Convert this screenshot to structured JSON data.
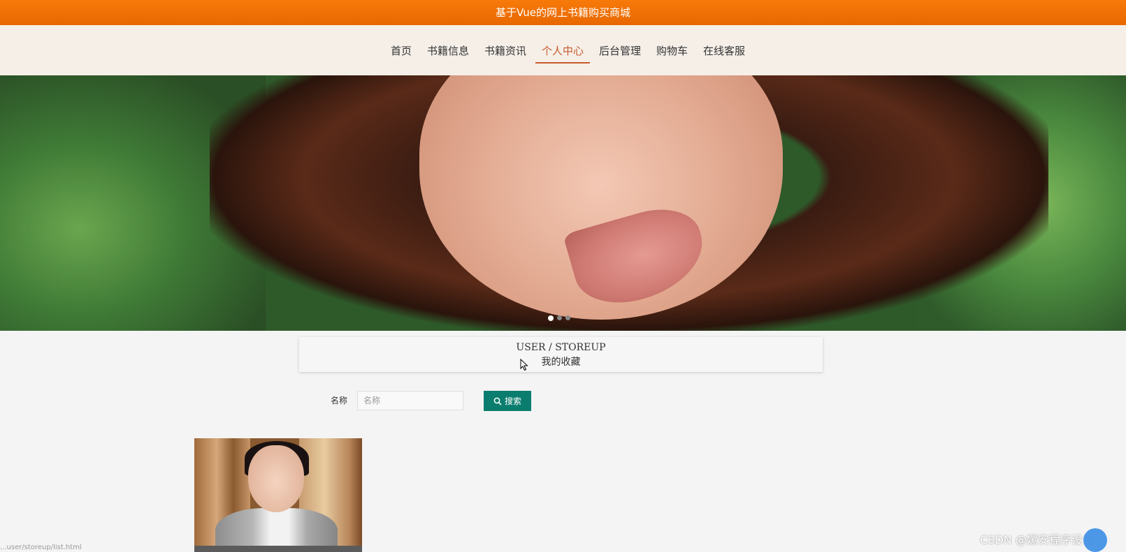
{
  "header": {
    "title": "基于Vue的网上书籍购买商城"
  },
  "nav": {
    "items": [
      {
        "label": "首页"
      },
      {
        "label": "书籍信息"
      },
      {
        "label": "书籍资讯"
      },
      {
        "label": "个人中心"
      },
      {
        "label": "后台管理"
      },
      {
        "label": "购物车"
      },
      {
        "label": "在线客服"
      }
    ],
    "active": "个人中心"
  },
  "banner": {
    "slides": 3,
    "active_slide": 1
  },
  "section": {
    "title_en": "USER / STOREUP",
    "title_zh": "我的收藏"
  },
  "search": {
    "label": "名称",
    "placeholder": "名称",
    "button_label": "搜索"
  },
  "status_url": "...user/storeup/list.html",
  "watermark": "CSDN @嫘安程序设计",
  "colors": {
    "topbar": "#f07005",
    "nav_bg": "#f5efe8",
    "active_nav": "#c85a2a",
    "search_button": "#0b7d6e"
  }
}
